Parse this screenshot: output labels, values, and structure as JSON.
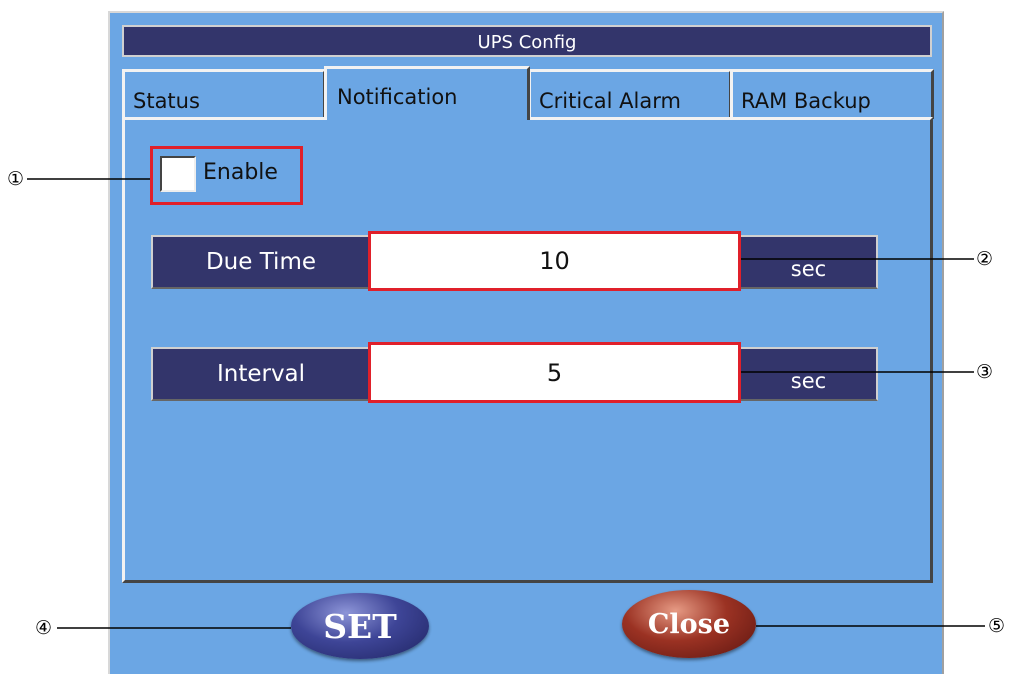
{
  "window": {
    "title": "UPS Config"
  },
  "tabs": [
    {
      "label": "Status"
    },
    {
      "label": "Notification"
    },
    {
      "label": "Critical Alarm"
    },
    {
      "label": "RAM Backup"
    }
  ],
  "enable": {
    "label": "Enable",
    "checked": false
  },
  "due_time": {
    "label": "Due Time",
    "value": "10",
    "unit": "sec"
  },
  "interval": {
    "label": "Interval",
    "value": "5",
    "unit": "sec"
  },
  "buttons": {
    "set_label": "SET",
    "close_label": "Close"
  },
  "callouts": [
    "①",
    "②",
    "③",
    "④",
    "⑤"
  ],
  "colors": {
    "window_bg": "#6ba6e4",
    "title_bg": "#33356b",
    "highlight": "#e0202a",
    "set_button": "#3e4597",
    "close_button": "#9b3223"
  }
}
